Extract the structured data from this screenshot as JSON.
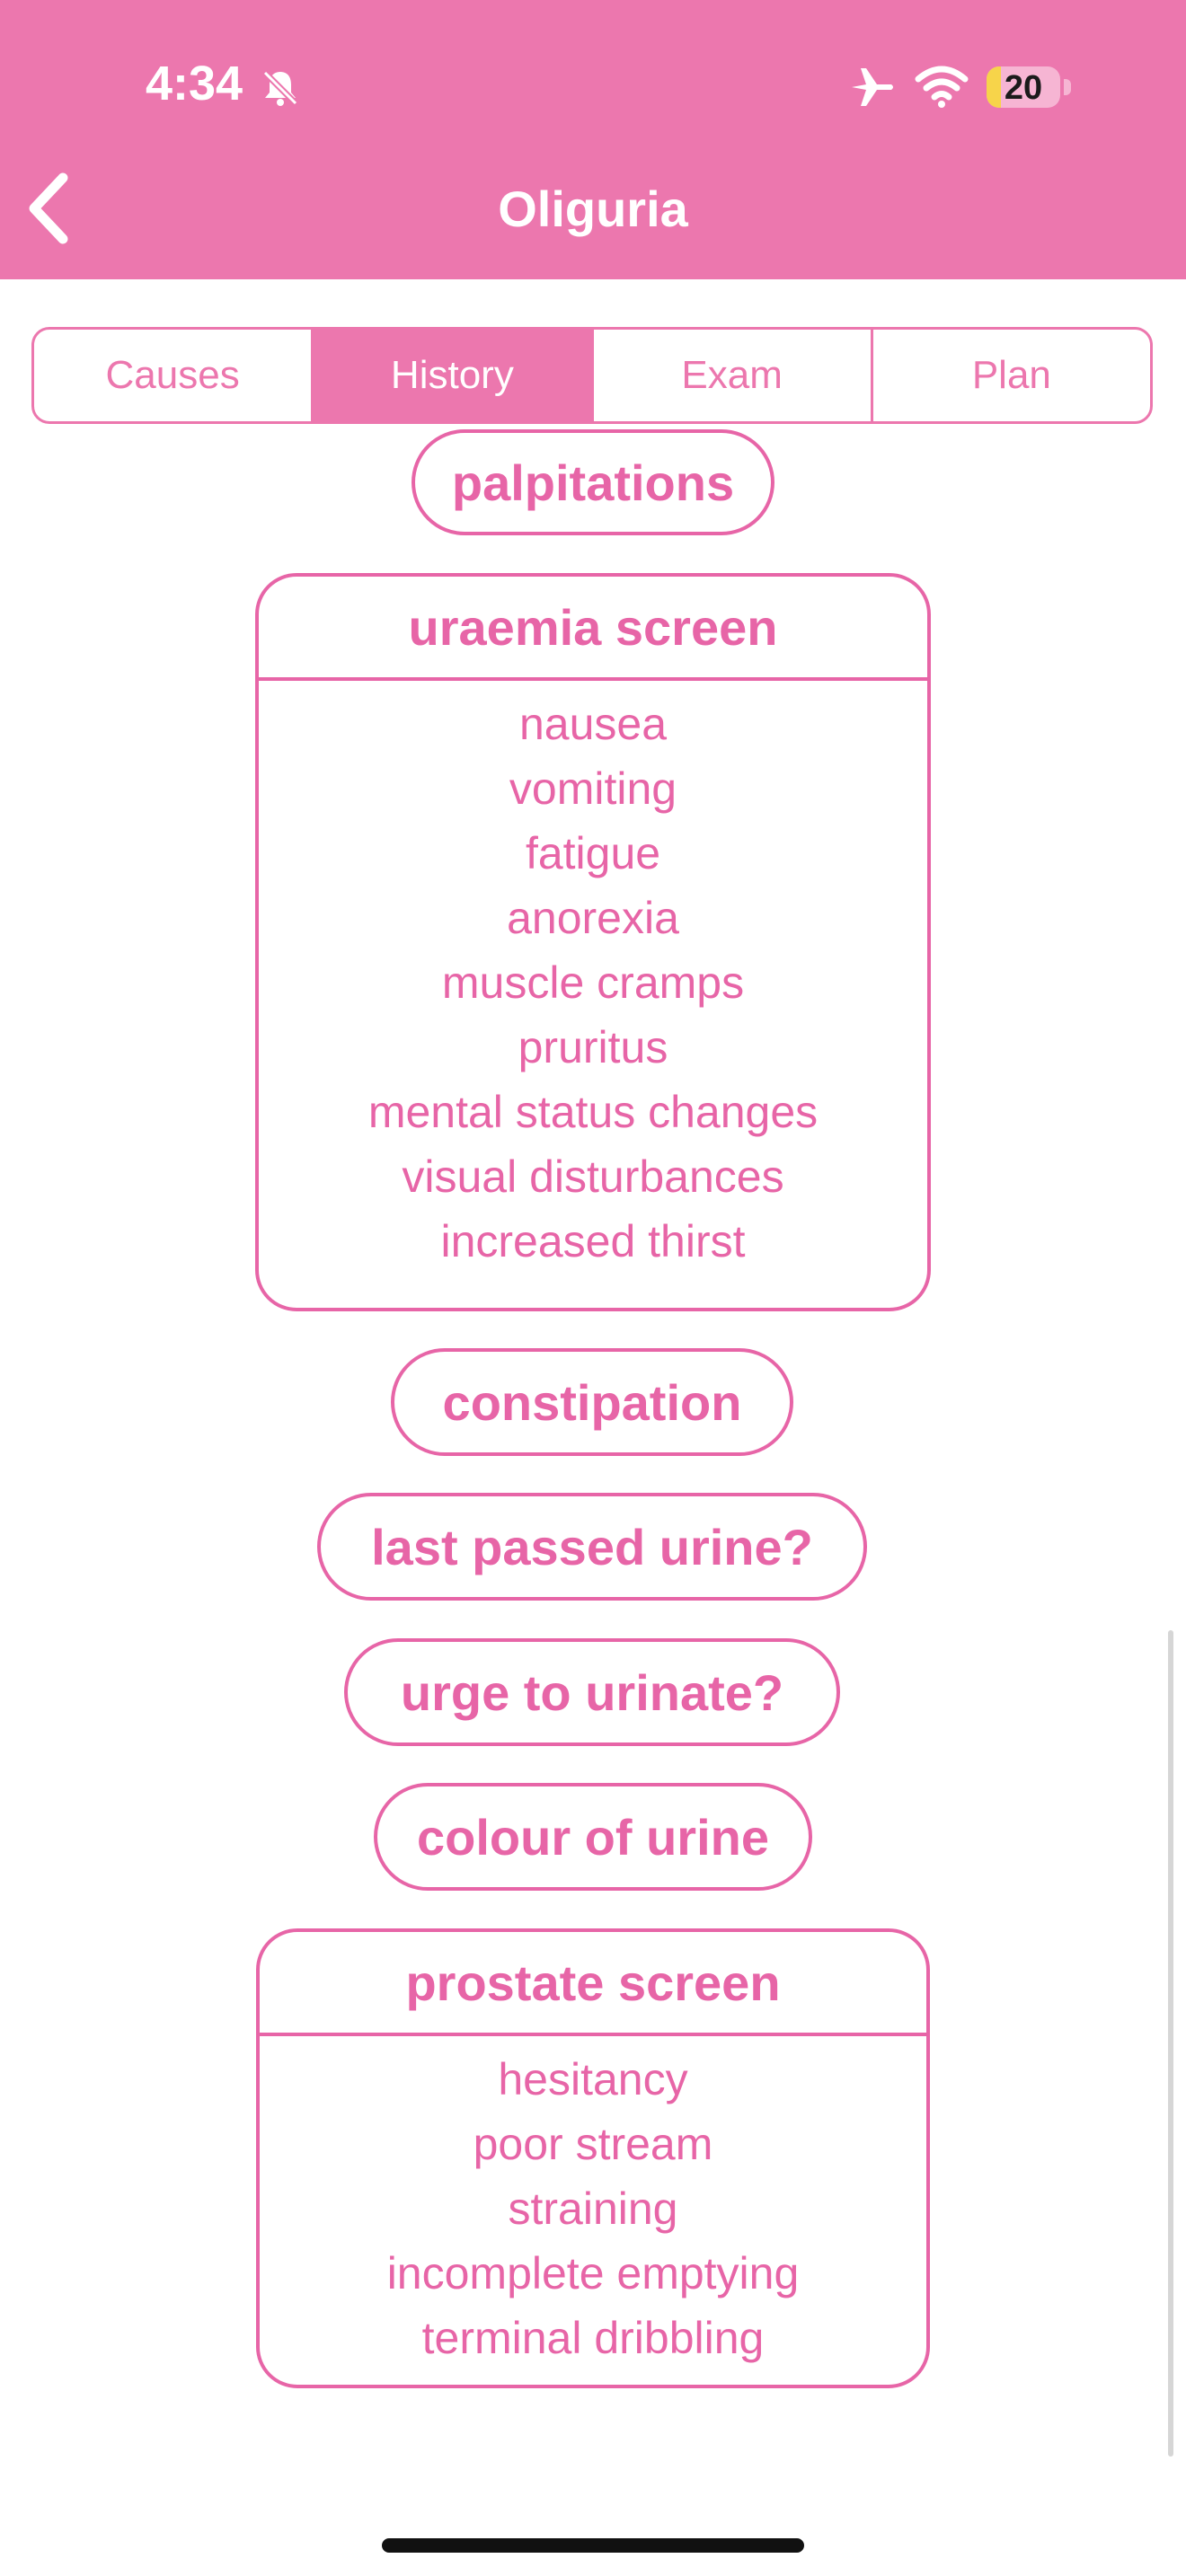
{
  "status_bar": {
    "time": "4:34",
    "battery": "20",
    "icons": [
      "bell-slash-icon",
      "airplane-icon",
      "wifi-icon",
      "battery-icon"
    ]
  },
  "header": {
    "title": "Oliguria",
    "back_icon": "chevron-left-icon"
  },
  "tabs": [
    {
      "label": "Causes",
      "active": false
    },
    {
      "label": "History",
      "active": true
    },
    {
      "label": "Exam",
      "active": false
    },
    {
      "label": "Plan",
      "active": false
    }
  ],
  "content": {
    "palpitations": "palpitations",
    "uraemia": {
      "title": "uraemia screen",
      "items": [
        "nausea",
        "vomiting",
        "fatigue",
        "anorexia",
        "muscle cramps",
        "pruritus",
        "mental status changes",
        "visual disturbances",
        "increased thirst"
      ]
    },
    "constipation": "constipation",
    "last_passed": "last passed urine?",
    "urge": "urge to urinate?",
    "colour": "colour of urine",
    "prostate": {
      "title": "prostate screen",
      "items": [
        "hesitancy",
        "poor stream",
        "straining",
        "incomplete emptying",
        "terminal dribbling"
      ]
    }
  },
  "colors": {
    "accent": "#ec77ae",
    "text": "#e765a7"
  }
}
